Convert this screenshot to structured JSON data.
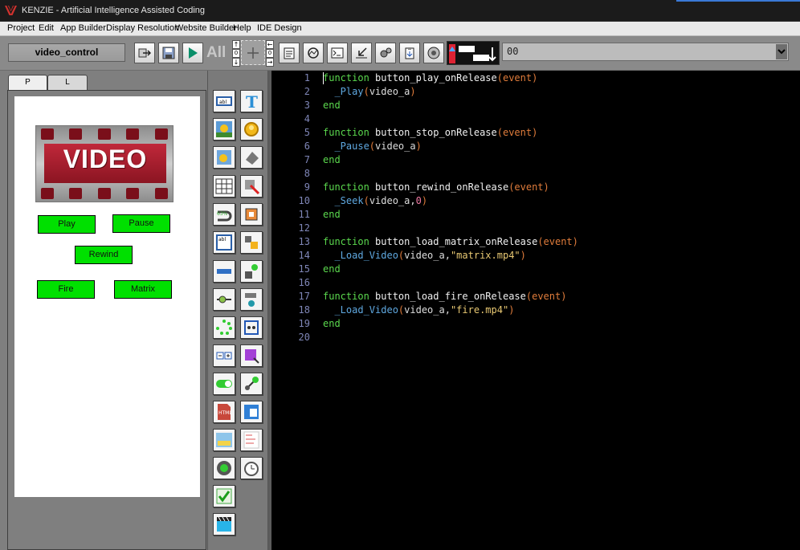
{
  "window": {
    "title": "KENZIE - Artificial Intelligence Assisted Coding"
  },
  "menu": [
    "Project",
    "Edit",
    "App Builder",
    "Display Resolution",
    "Website Builder",
    "Help",
    "IDE Design"
  ],
  "toolbar": {
    "control_name": "video_control",
    "all_label": "All",
    "combo_value": "00",
    "icons": [
      "export-icon",
      "save-icon",
      "play-icon",
      "move-icon",
      "properties-icon",
      "refresh-icon",
      "terminal-icon",
      "import-icon",
      "settings-icon",
      "clipboard-icon",
      "record-icon",
      "layer-order-icon"
    ]
  },
  "left_panel": {
    "tabs": [
      "P",
      "L"
    ],
    "banner_text": "VIDEO",
    "buttons": {
      "play": "Play",
      "pause": "Pause",
      "rewind": "Rewind",
      "fire": "Fire",
      "matrix": "Matrix"
    }
  },
  "palette": {
    "items": [
      "textbox-icon",
      "text-icon",
      "image-icon",
      "button-icon",
      "image-gallery-icon",
      "shape-icon",
      "table-icon",
      "hotspot-icon",
      "progress-icon",
      "crop-icon",
      "textarea-icon",
      "layers-icon",
      "slider-icon",
      "diagram-icon",
      "scroll-icon",
      "connector-icon",
      "spinner-icon",
      "grid-icon",
      "stepper-icon",
      "select-icon",
      "toggle-icon",
      "link-icon",
      "html-icon",
      "web-icon",
      "map-icon",
      "report-icon",
      "radio-icon",
      "timer-icon",
      "checkbox-icon",
      "video-icon"
    ]
  },
  "editor": {
    "lines": [
      {
        "n": "1",
        "tokens": [
          [
            "kw",
            "function"
          ],
          [
            "fn",
            " button_play_onRelease"
          ],
          [
            "par",
            "(event)"
          ]
        ]
      },
      {
        "n": "2",
        "tokens": [
          [
            "api",
            "  _Play"
          ],
          [
            "par",
            "("
          ],
          [
            "arg",
            "video_a"
          ],
          [
            "par",
            ")"
          ]
        ]
      },
      {
        "n": "3",
        "tokens": [
          [
            "kw",
            "end"
          ]
        ]
      },
      {
        "n": "4",
        "tokens": []
      },
      {
        "n": "5",
        "tokens": [
          [
            "kw",
            "function"
          ],
          [
            "fn",
            " button_stop_onRelease"
          ],
          [
            "par",
            "(event)"
          ]
        ]
      },
      {
        "n": "6",
        "tokens": [
          [
            "api",
            "  _Pause"
          ],
          [
            "par",
            "("
          ],
          [
            "arg",
            "video_a"
          ],
          [
            "par",
            ")"
          ]
        ]
      },
      {
        "n": "7",
        "tokens": [
          [
            "kw",
            "end"
          ]
        ]
      },
      {
        "n": "8",
        "tokens": []
      },
      {
        "n": "9",
        "tokens": [
          [
            "kw",
            "function"
          ],
          [
            "fn",
            " button_rewind_onRelease"
          ],
          [
            "par",
            "(event)"
          ]
        ]
      },
      {
        "n": "10",
        "tokens": [
          [
            "api",
            "  _Seek"
          ],
          [
            "par",
            "("
          ],
          [
            "arg",
            "video_a,"
          ],
          [
            "num",
            "0"
          ],
          [
            "par",
            ")"
          ]
        ]
      },
      {
        "n": "11",
        "tokens": [
          [
            "kw",
            "end"
          ]
        ]
      },
      {
        "n": "12",
        "tokens": []
      },
      {
        "n": "13",
        "tokens": [
          [
            "kw",
            "function"
          ],
          [
            "fn",
            " button_load_matrix_onRelease"
          ],
          [
            "par",
            "(event)"
          ]
        ]
      },
      {
        "n": "14",
        "tokens": [
          [
            "api",
            "  _Load_Video"
          ],
          [
            "par",
            "("
          ],
          [
            "arg",
            "video_a,"
          ],
          [
            "str",
            "\"matrix.mp4\""
          ],
          [
            "par",
            ")"
          ]
        ]
      },
      {
        "n": "15",
        "tokens": [
          [
            "kw",
            "end"
          ]
        ]
      },
      {
        "n": "16",
        "tokens": []
      },
      {
        "n": "17",
        "tokens": [
          [
            "kw",
            "function"
          ],
          [
            "fn",
            " button_load_fire_onRelease"
          ],
          [
            "par",
            "(event)"
          ]
        ]
      },
      {
        "n": "18",
        "tokens": [
          [
            "api",
            "  _Load_Video"
          ],
          [
            "par",
            "("
          ],
          [
            "arg",
            "video_a,"
          ],
          [
            "str",
            "\"fire.mp4\""
          ],
          [
            "par",
            ")"
          ]
        ]
      },
      {
        "n": "19",
        "tokens": [
          [
            "kw",
            "end"
          ]
        ]
      },
      {
        "n": "20",
        "tokens": []
      }
    ]
  },
  "colors": {
    "accent": "#3a79d6",
    "button_green": "#00e000",
    "keyword": "#5bd94e",
    "editor_bg": "#000000"
  }
}
